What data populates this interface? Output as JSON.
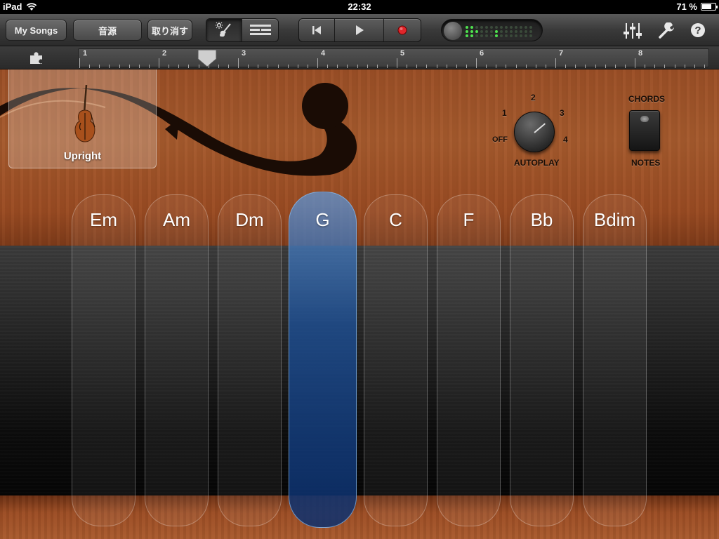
{
  "status_bar": {
    "device": "iPad",
    "time": "22:32",
    "battery_text": "71 %",
    "battery_level": 0.71
  },
  "toolbar": {
    "my_songs": "My Songs",
    "sounds": "音源",
    "undo": "取り消す",
    "view_toggle": [
      "guitar-icon",
      "tracks-icon"
    ],
    "transport": [
      "go-to-start-icon",
      "play-icon",
      "record-icon"
    ],
    "right_icons": [
      "mixer-icon",
      "wrench-icon",
      "help-icon"
    ]
  },
  "ruler": {
    "bars": [
      "1",
      "2",
      "3",
      "4",
      "5",
      "6",
      "7",
      "8"
    ]
  },
  "instrument": {
    "name": "Upright"
  },
  "autoplay": {
    "label": "AUTOPLAY",
    "positions": [
      "OFF",
      "1",
      "2",
      "3",
      "4"
    ],
    "selected": "3"
  },
  "mode_switch": {
    "top_label": "CHORDS",
    "bottom_label": "NOTES"
  },
  "chords": {
    "items": [
      "Em",
      "Am",
      "Dm",
      "G",
      "C",
      "F",
      "Bb",
      "Bdim"
    ],
    "selected": "G"
  },
  "colors": {
    "wood": "#a55a2d",
    "selected_strip": "#1e5096",
    "meter_led": "#4ee24e",
    "record": "#e0262b"
  }
}
